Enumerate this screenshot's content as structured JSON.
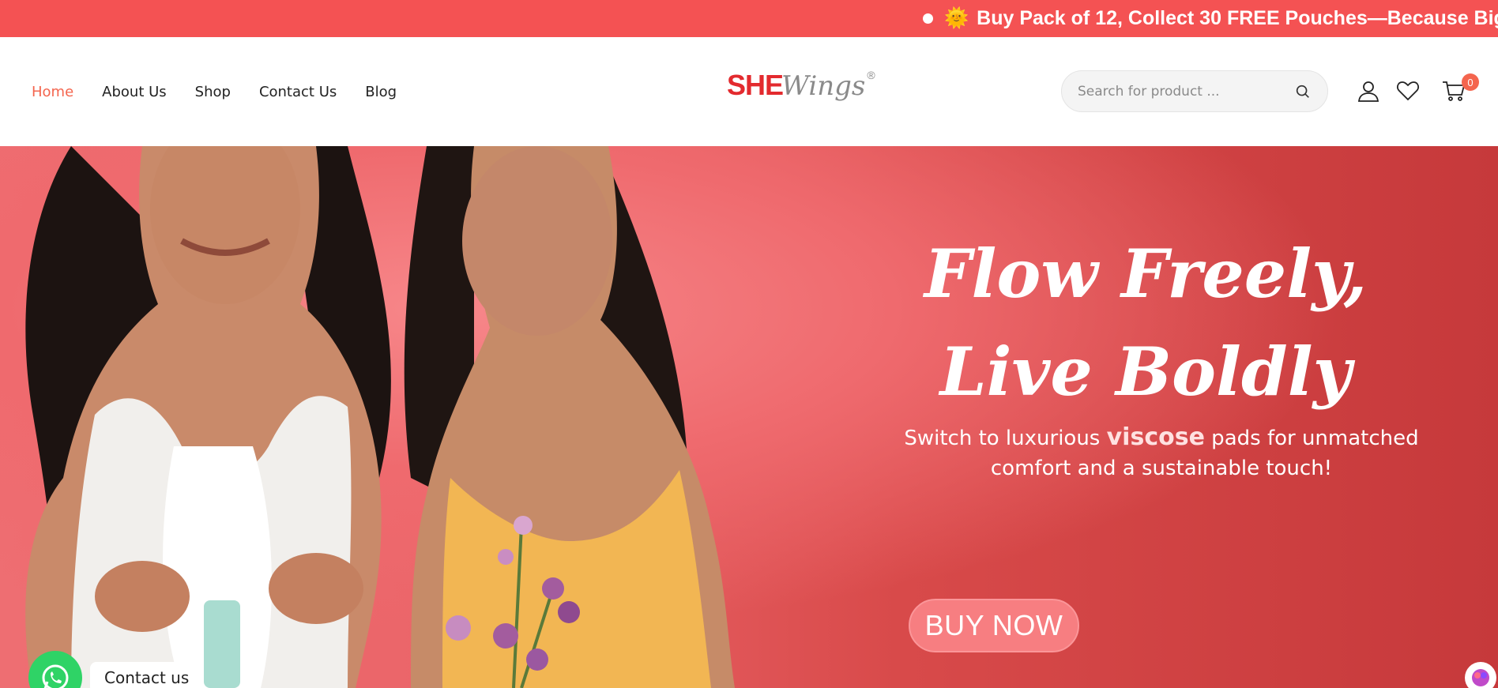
{
  "announcement": {
    "text": "Buy Pack of 12, Collect 30 FREE Pouches—Because Bigger",
    "sun_emoji": "🌞"
  },
  "nav": {
    "items": [
      {
        "label": "Home",
        "active": true
      },
      {
        "label": "About Us"
      },
      {
        "label": "Shop"
      },
      {
        "label": "Contact Us"
      },
      {
        "label": "Blog"
      }
    ]
  },
  "logo": {
    "she": "SHE",
    "wings": "Wings",
    "reg": "®"
  },
  "search": {
    "placeholder": "Search for product ..."
  },
  "cart": {
    "count": "0"
  },
  "hero": {
    "title_line1": "Flow Freely,",
    "title_line2": "Live Boldly",
    "sub_before": "Switch to luxurious ",
    "sub_em": "viscose",
    "sub_after": " pads for unmatched comfort and a sustainable touch!",
    "cta": "BUY NOW"
  },
  "whatsapp": {
    "label": "Contact us"
  },
  "colors": {
    "announcement_bg": "#f45253",
    "accent": "#f4654e",
    "logo_red": "#e32a2e",
    "whatsapp_green": "#2fd366",
    "hero_bg": "#d84a4a"
  }
}
